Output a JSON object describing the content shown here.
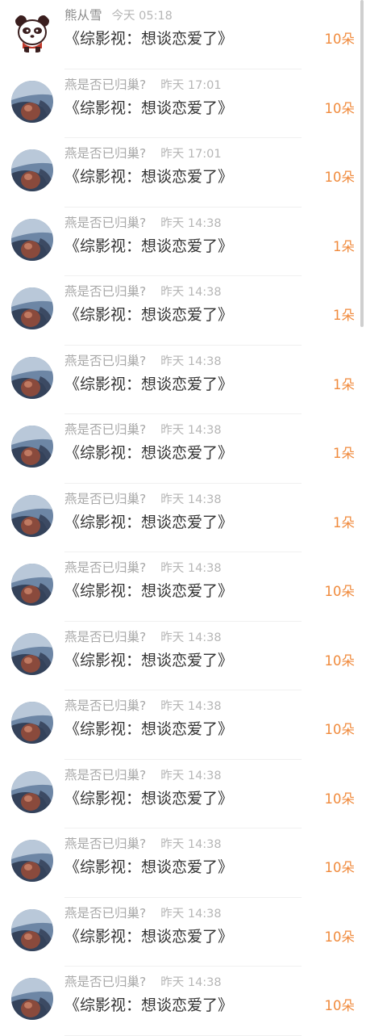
{
  "messages": [
    {
      "name": "熊从雪",
      "time": "今天 05:18",
      "title": "《综影视：想谈恋爱了》",
      "count": "10朵",
      "avatar_icon": "panda-avatar-icon"
    },
    {
      "name": "燕是否已归巢?",
      "time": "昨天 17:01",
      "title": "《综影视：想谈恋爱了》",
      "count": "10朵",
      "avatar_icon": "photo-avatar-icon"
    },
    {
      "name": "燕是否已归巢?",
      "time": "昨天 17:01",
      "title": "《综影视：想谈恋爱了》",
      "count": "10朵",
      "avatar_icon": "photo-avatar-icon"
    },
    {
      "name": "燕是否已归巢?",
      "time": "昨天 14:38",
      "title": "《综影视：想谈恋爱了》",
      "count": "1朵",
      "avatar_icon": "photo-avatar-icon"
    },
    {
      "name": "燕是否已归巢?",
      "time": "昨天 14:38",
      "title": "《综影视：想谈恋爱了》",
      "count": "1朵",
      "avatar_icon": "photo-avatar-icon"
    },
    {
      "name": "燕是否已归巢?",
      "time": "昨天 14:38",
      "title": "《综影视：想谈恋爱了》",
      "count": "1朵",
      "avatar_icon": "photo-avatar-icon"
    },
    {
      "name": "燕是否已归巢?",
      "time": "昨天 14:38",
      "title": "《综影视：想谈恋爱了》",
      "count": "1朵",
      "avatar_icon": "photo-avatar-icon"
    },
    {
      "name": "燕是否已归巢?",
      "time": "昨天 14:38",
      "title": "《综影视：想谈恋爱了》",
      "count": "1朵",
      "avatar_icon": "photo-avatar-icon"
    },
    {
      "name": "燕是否已归巢?",
      "time": "昨天 14:38",
      "title": "《综影视：想谈恋爱了》",
      "count": "10朵",
      "avatar_icon": "photo-avatar-icon"
    },
    {
      "name": "燕是否已归巢?",
      "time": "昨天 14:38",
      "title": "《综影视：想谈恋爱了》",
      "count": "10朵",
      "avatar_icon": "photo-avatar-icon"
    },
    {
      "name": "燕是否已归巢?",
      "time": "昨天 14:38",
      "title": "《综影视：想谈恋爱了》",
      "count": "10朵",
      "avatar_icon": "photo-avatar-icon"
    },
    {
      "name": "燕是否已归巢?",
      "time": "昨天 14:38",
      "title": "《综影视：想谈恋爱了》",
      "count": "10朵",
      "avatar_icon": "photo-avatar-icon"
    },
    {
      "name": "燕是否已归巢?",
      "time": "昨天 14:38",
      "title": "《综影视：想谈恋爱了》",
      "count": "10朵",
      "avatar_icon": "photo-avatar-icon"
    },
    {
      "name": "燕是否已归巢?",
      "time": "昨天 14:38",
      "title": "《综影视：想谈恋爱了》",
      "count": "10朵",
      "avatar_icon": "photo-avatar-icon"
    },
    {
      "name": "燕是否已归巢?",
      "time": "昨天 14:38",
      "title": "《综影视：想谈恋爱了》",
      "count": "10朵",
      "avatar_icon": "photo-avatar-icon"
    }
  ],
  "colors": {
    "count_accent": "#f08a3c",
    "title_text": "#333333",
    "meta_text": "#a8a8a8",
    "divider": "#f0f0f0",
    "scrollbar": "#cfcfcf"
  }
}
